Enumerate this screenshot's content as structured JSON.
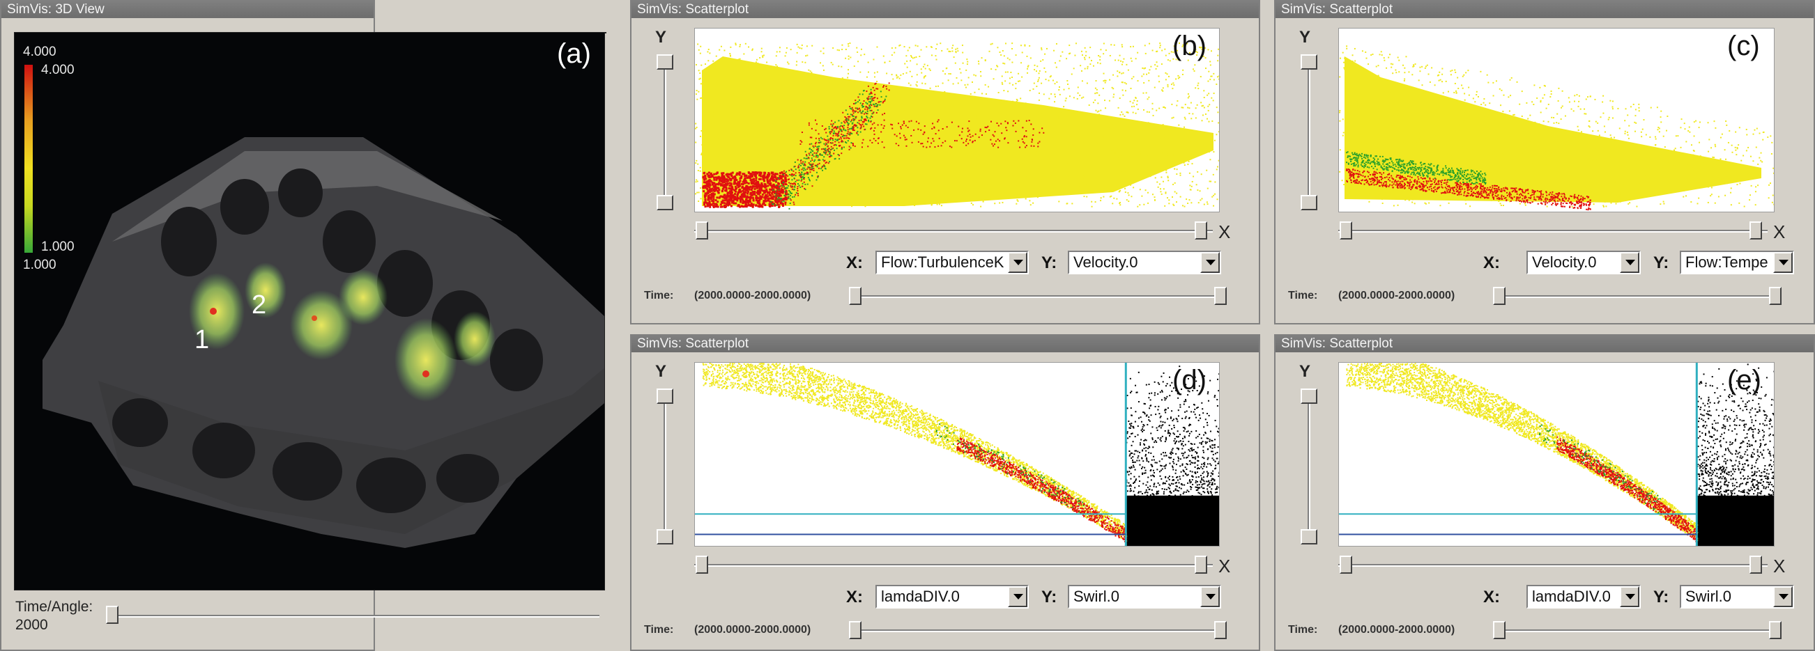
{
  "windows": {
    "view3d": {
      "title": "SimVis: 3D View",
      "panel_label": "(a)",
      "legend": {
        "top_outer": "4.000",
        "top_inner": "4.000",
        "bottom_inner": "1.000",
        "bottom_outer": "1.000"
      },
      "markers": [
        "1",
        "2"
      ],
      "slider": {
        "label": "Time/Angle:",
        "value": "2000"
      }
    },
    "scatter_b": {
      "title": "SimVis: Scatterplot",
      "panel_label": "(b)",
      "x_axis": "Flow:TurbulenceK",
      "y_axis": "Velocity.0",
      "time_label": "Time:",
      "time_range": "(2000.0000-2000.0000)"
    },
    "scatter_c": {
      "title": "SimVis: Scatterplot",
      "panel_label": "(c)",
      "x_axis": "Velocity.0",
      "y_axis": "Flow:Tempe",
      "time_label": "Time:",
      "time_range": "(2000.0000-2000.0000)"
    },
    "scatter_d": {
      "title": "SimVis: Scatterplot",
      "panel_label": "(d)",
      "x_axis": "lamdaDIV.0",
      "y_axis": "Swirl.0",
      "time_label": "Time:",
      "time_range": "(2000.0000-2000.0000)"
    },
    "scatter_e": {
      "title": "SimVis: Scatterplot",
      "panel_label": "(e)",
      "x_axis": "lamdaDIV.0",
      "y_axis": "Swirl.0",
      "time_label": "Time:",
      "time_range": "(2000.0000-2000.0000)"
    }
  },
  "common": {
    "y_letter": "Y",
    "x_letter": "X",
    "x_close": "×",
    "x_label": "X:",
    "y_label": "Y:"
  },
  "colors": {
    "selected": "#e01010",
    "focus": "#f0e820",
    "context": "#2aa02a",
    "brush_line": "#30b0c0"
  }
}
